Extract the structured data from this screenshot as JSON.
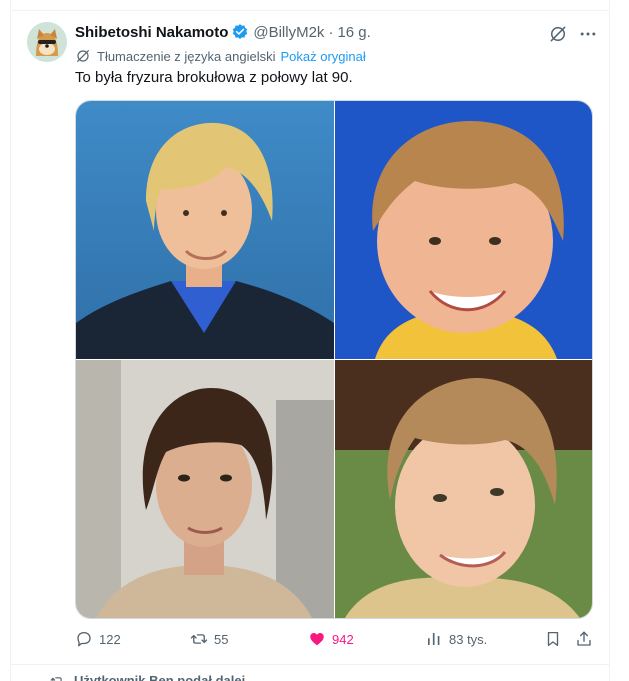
{
  "tweet": {
    "display_name": "Shibetoshi Nakamoto",
    "handle": "@BillyM2k",
    "separator": "·",
    "time": "16 g.",
    "translated_from": "Tłumaczenie z języka angielski",
    "show_original": "Pokaż oryginał",
    "text": "To była fryzura brokułowa z połowy lat 90."
  },
  "actions": {
    "replies": "122",
    "reposts": "55",
    "likes": "942",
    "views": "83 tys."
  },
  "next_item": {
    "retweet_note": "Użytkownik Ben podał dalej"
  },
  "icons": {
    "avatar": "doge-avatar",
    "verified": "verified-badge-icon",
    "grok": "grok-icon",
    "more": "more-icon",
    "translate": "translate-icon",
    "reply": "reply-icon",
    "repost": "repost-icon",
    "like": "heart-icon",
    "views": "views-icon",
    "bookmark": "bookmark-icon",
    "share": "share-icon"
  },
  "colors": {
    "accent": "#1d9bf0",
    "like": "#f91880",
    "secondary_text": "#536471"
  }
}
